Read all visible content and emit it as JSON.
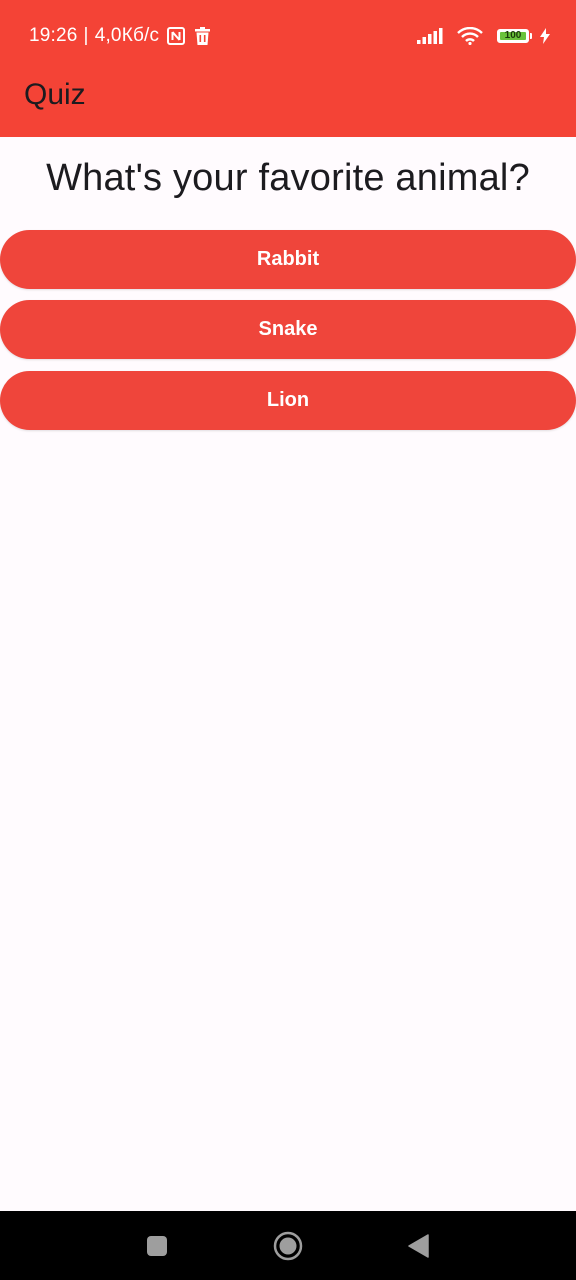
{
  "status_bar": {
    "time": "19:26",
    "separator": "|",
    "speed": "4,0Кб/с",
    "battery_level": "100",
    "icons": [
      "nfc-icon",
      "trash-icon",
      "signal-icon",
      "wifi-icon",
      "battery-icon",
      "charging-icon"
    ]
  },
  "app_bar": {
    "title": "Quiz"
  },
  "quiz": {
    "question": "What's your favorite animal?",
    "answers": [
      {
        "label": "Rabbit"
      },
      {
        "label": "Snake"
      },
      {
        "label": "Lion"
      }
    ]
  },
  "nav_bar": {
    "icons": [
      "recent-apps-icon",
      "home-icon",
      "back-icon"
    ]
  },
  "colors": {
    "primary": "#f44336",
    "button": "#ef453b",
    "background": "#fffbfe",
    "text": "#1c1b1f",
    "battery": "#6ac23b"
  }
}
